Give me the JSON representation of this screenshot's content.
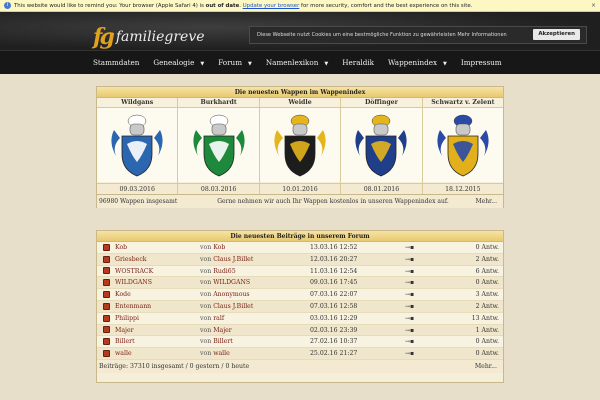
{
  "browser_warning": {
    "prefix": "This website would like to remind you: Your browser (Apple Safari 4) is ",
    "bold": "out of date",
    "middle": ". ",
    "link": "Update your browser",
    "suffix": " for more security, comfort and the best experience on this site.",
    "close": "×"
  },
  "header": {
    "logo_mark": "fg",
    "logo_text": "familiegreve"
  },
  "cookie": {
    "text": "Diese Webseite nutzt Cookies um eine bestmögliche Funktion zu gewährleisten ",
    "link": "Mehr Informationen",
    "accept": "Akzeptieren"
  },
  "nav": [
    {
      "label": "Stammdaten",
      "dropdown": false
    },
    {
      "label": "Genealogie",
      "dropdown": true
    },
    {
      "label": "Forum",
      "dropdown": true
    },
    {
      "label": "Namenlexikon",
      "dropdown": true
    },
    {
      "label": "Heraldik",
      "dropdown": false
    },
    {
      "label": "Wappenindex",
      "dropdown": true
    },
    {
      "label": "Impressum",
      "dropdown": false
    }
  ],
  "wappen": {
    "title": "Die neuesten Wappen im Wappenindex",
    "items": [
      {
        "name": "Wildgans",
        "date": "09.03.2016"
      },
      {
        "name": "Burkhardt",
        "date": "08.03.2016"
      },
      {
        "name": "Weidle",
        "date": "10.01.2016"
      },
      {
        "name": "Döffinger",
        "date": "08.01.2016"
      },
      {
        "name": "Schwartz v. Zelent",
        "date": "18.12.2015"
      }
    ],
    "count": "96980 Wappen insgesamt",
    "notice": "Gerne nehmen wir auch Ihr Wappen kostenlos in unseren Wappenindex auf.",
    "more": "Mehr..."
  },
  "forum": {
    "title": "Die neuesten Beiträge in unserem Forum",
    "von": "von",
    "arrow": "→▪",
    "rows": [
      {
        "title": "Kob",
        "author": "Kob",
        "date": "13.03.16 12:52",
        "answers": "0 Antw."
      },
      {
        "title": "Griesbeck",
        "author": "Claus J.Billet",
        "date": "12.03.16 20:27",
        "answers": "2 Antw."
      },
      {
        "title": "WOSTRACK",
        "author": "Rudi65",
        "date": "11.03.16 12:54",
        "answers": "6 Antw."
      },
      {
        "title": "WILDGANS",
        "author": "WILDGANS",
        "date": "09.03.16 17:45",
        "answers": "0 Antw."
      },
      {
        "title": "Kode",
        "author": "Anonymous",
        "date": "07.03.16 22:07",
        "answers": "3 Antw."
      },
      {
        "title": "Entenmann",
        "author": "Claus J.Billet",
        "date": "07.03.16 12:58",
        "answers": "2 Antw."
      },
      {
        "title": "Philippi",
        "author": "ralf",
        "date": "03.03.16 12:29",
        "answers": "13 Antw."
      },
      {
        "title": "Majer",
        "author": "Majer",
        "date": "02.03.16 23:39",
        "answers": "1 Antw."
      },
      {
        "title": "Billert",
        "author": "Billert",
        "date": "27.02.16 10:37",
        "answers": "0 Antw."
      },
      {
        "title": "walle",
        "author": "walle",
        "date": "25.02.16 21:27",
        "answers": "0 Antw."
      }
    ],
    "stats": "Beiträge: 37310 insgesamt / 0 gestern / 0 heute",
    "more": "Mehr..."
  }
}
